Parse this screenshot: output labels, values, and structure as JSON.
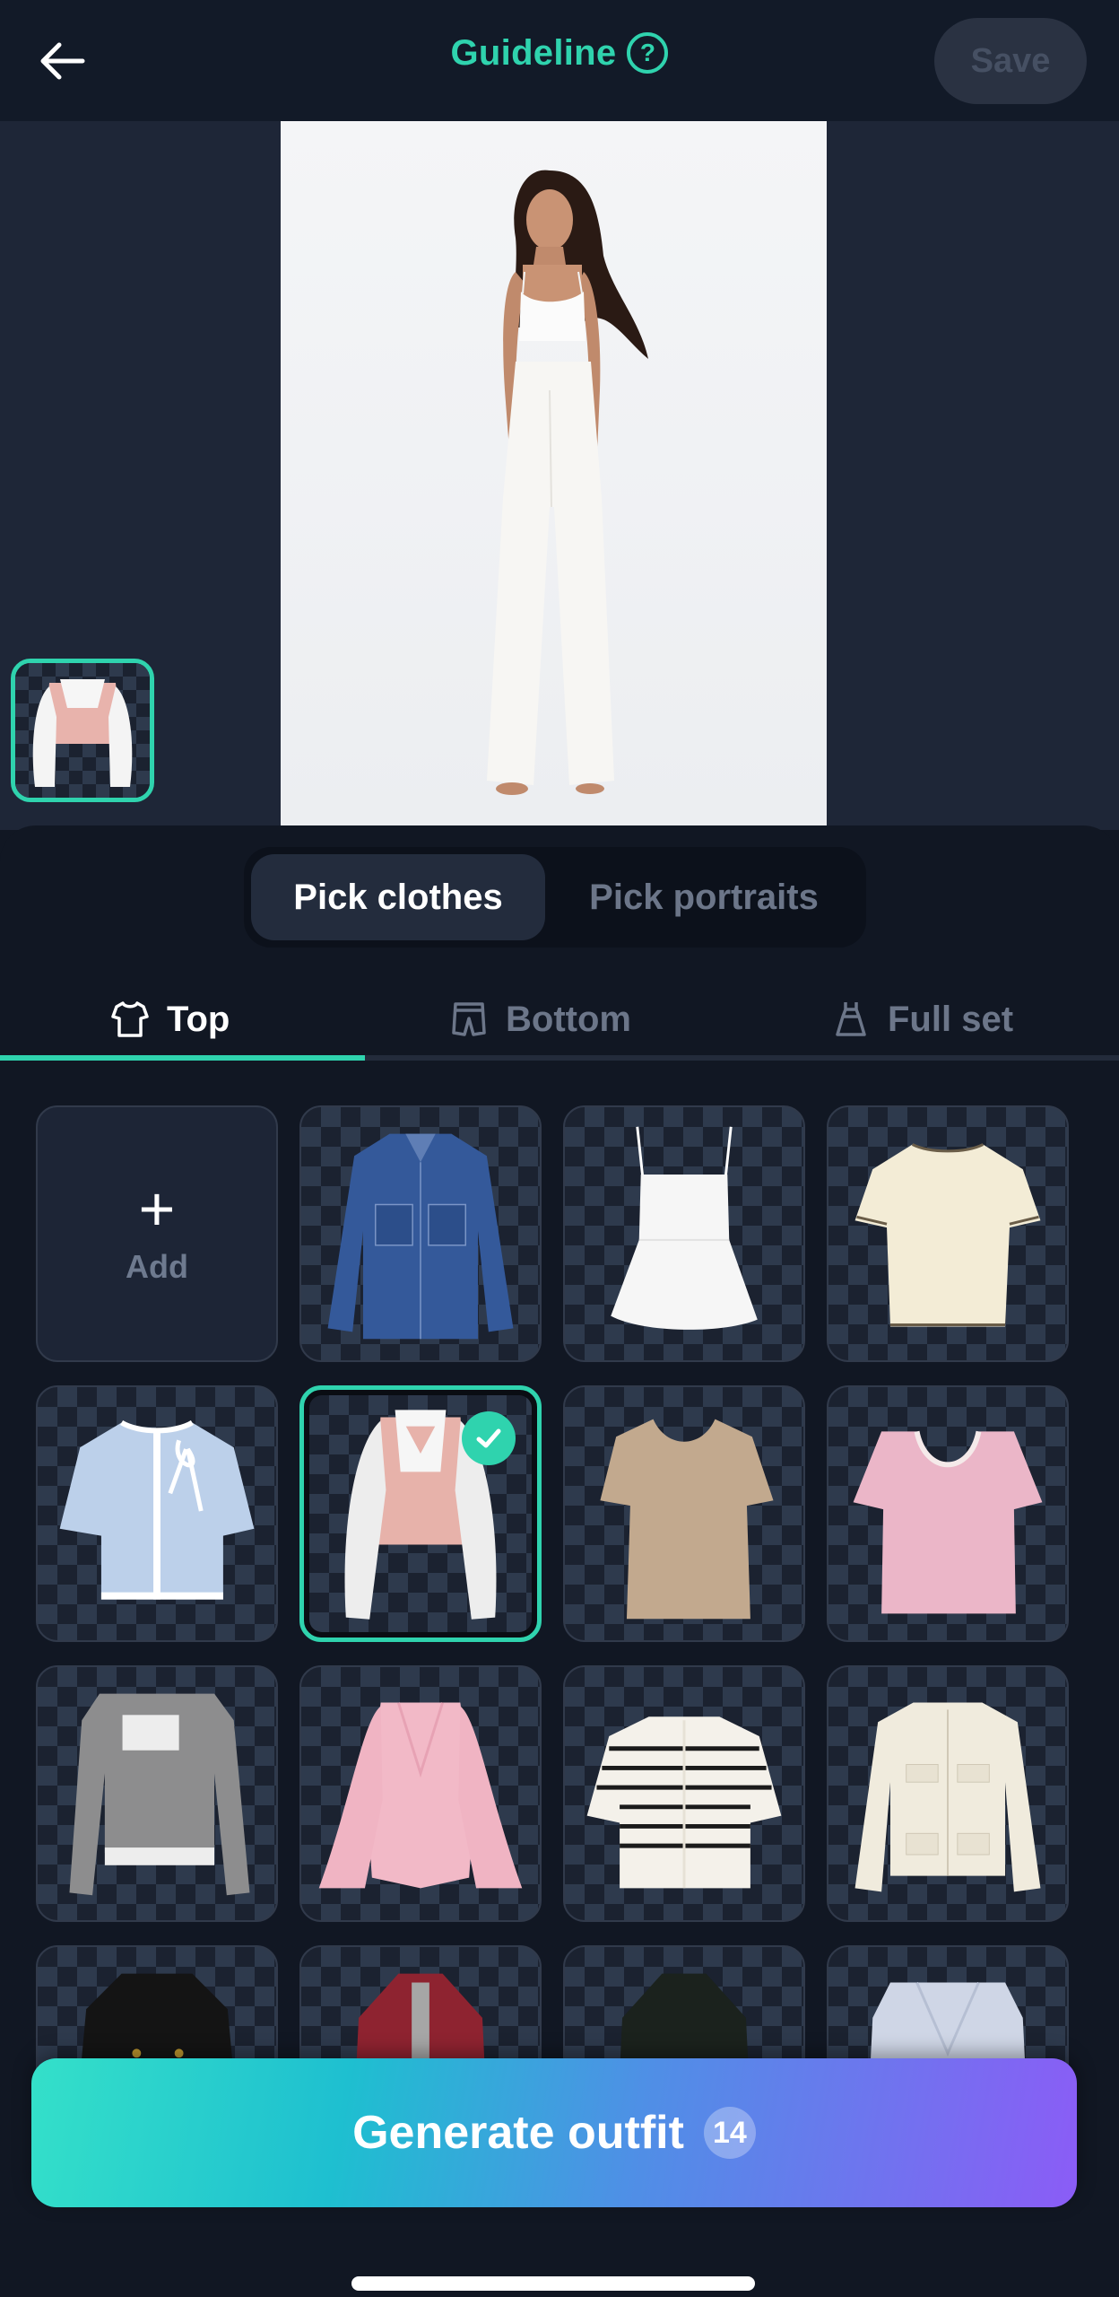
{
  "header": {
    "title": "Guideline",
    "save_label": "Save",
    "accent_color": "#2fd3ae"
  },
  "preview": {
    "portrait_alt": "Model in white camisole crop top and wide-leg white pants",
    "selected_thumb_alt": "Pink vest with white puff sleeves blouse"
  },
  "segment": {
    "options": [
      "Pick clothes",
      "Pick portraits"
    ],
    "selected": "Pick clothes"
  },
  "category_tabs": [
    {
      "label": "Top",
      "icon": "tshirt-icon",
      "active": true
    },
    {
      "label": "Bottom",
      "icon": "shorts-icon",
      "active": false
    },
    {
      "label": "Full set",
      "icon": "dress-icon",
      "active": false
    }
  ],
  "grid": {
    "add_label": "Add",
    "items": [
      {
        "name": "Denim jacket",
        "selected": false
      },
      {
        "name": "White cami peplum top",
        "selected": false
      },
      {
        "name": "Cream tee with contrast trim",
        "selected": false
      },
      {
        "name": "Light blue bow cardigan",
        "selected": false
      },
      {
        "name": "Pink vest puff sleeve blouse",
        "selected": true
      },
      {
        "name": "Beige scoop-neck tee",
        "selected": false
      },
      {
        "name": "Pink lace square-neck top",
        "selected": false
      },
      {
        "name": "Grey layered henley",
        "selected": false
      },
      {
        "name": "Pink bell-sleeve blouse",
        "selected": false
      },
      {
        "name": "Striped short-sleeve cardigan",
        "selected": false
      },
      {
        "name": "Cream tweed jacket",
        "selected": false
      },
      {
        "name": "Black double-breasted coat",
        "selected": false
      },
      {
        "name": "Burgundy coat",
        "selected": false
      },
      {
        "name": "Dark green blazer",
        "selected": false
      },
      {
        "name": "Light blue cardigan",
        "selected": false
      }
    ]
  },
  "generate": {
    "label": "Generate outfit",
    "credits": "14"
  }
}
